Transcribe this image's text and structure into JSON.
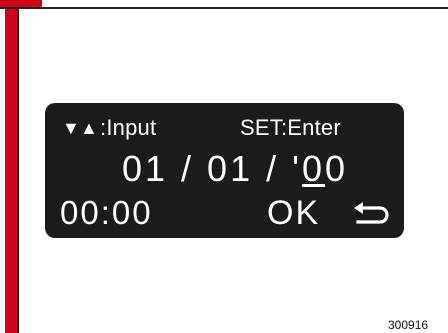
{
  "display": {
    "hint_arrows": "▼▲",
    "hint_input": ":Input",
    "hint_set": "SET:Enter",
    "date_prefix": "01 / 01 / '",
    "date_cursor_digit": "0",
    "date_suffix": "0",
    "time": "00:00",
    "ok_label": "OK",
    "return_icon": "return-arrow-icon"
  },
  "figure_number": "300916",
  "colors": {
    "accent_red": "#d0021b",
    "lcd_background": "#1b1b1b",
    "lcd_text": "#ffffff"
  }
}
